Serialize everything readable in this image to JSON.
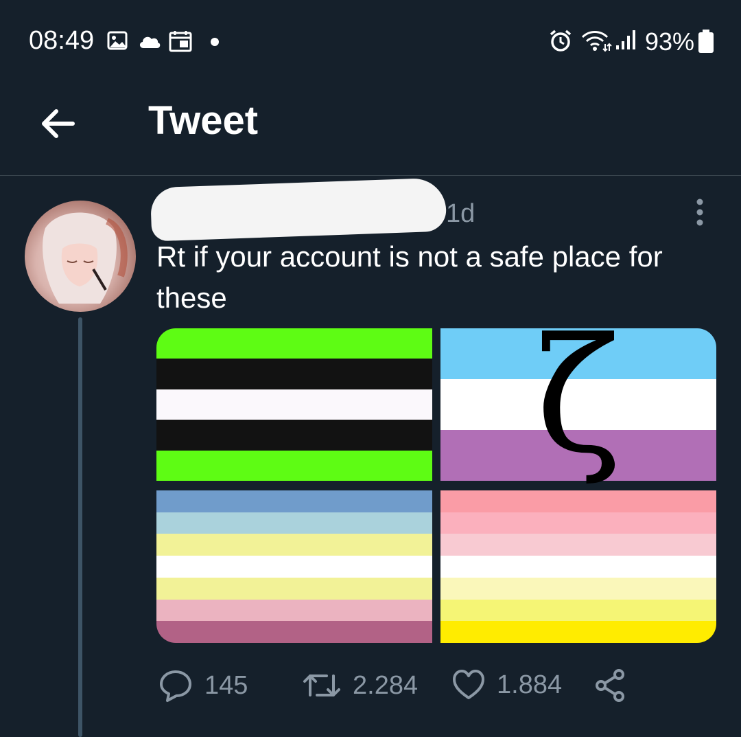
{
  "status_bar": {
    "time": "08:49",
    "icons": [
      "image-icon",
      "cloud-icon",
      "calendar-icon",
      "dot-icon",
      "alarm-icon",
      "wifi-icon",
      "signal-icon",
      "battery-icon"
    ],
    "battery": "93%"
  },
  "header": {
    "title": "Tweet",
    "back_icon": "arrow-left-icon"
  },
  "tweet": {
    "timestamp": "1d",
    "text": "Rt if your account is not a safe place for these",
    "more_icon": "more-vertical-icon",
    "actions": {
      "replies": "145",
      "retweets": "2.284",
      "likes": "1.884"
    }
  },
  "media": {
    "flags": [
      {
        "colors": [
          "#5efc14",
          "#121212",
          "#fbf8fc",
          "#121212",
          "#5efc14"
        ],
        "symbol": ""
      },
      {
        "colors": [
          "#6fcdf7",
          "#ffffff",
          "#b16fb6"
        ],
        "symbol": "ζ"
      },
      {
        "colors": [
          "#709ccb",
          "#aad2dc",
          "#f2f297",
          "#ffffff",
          "#f2f297",
          "#ebb3c0",
          "#b26286"
        ],
        "symbol": ""
      },
      {
        "colors": [
          "#fa9ca6",
          "#fbb0bd",
          "#f8cad2",
          "#ffffff",
          "#faf7ba",
          "#f5f575",
          "#ffec00"
        ],
        "symbol": ""
      }
    ]
  },
  "colors": {
    "background": "#15202b",
    "secondary_text": "#8b98a5",
    "divider": "#38444d"
  }
}
